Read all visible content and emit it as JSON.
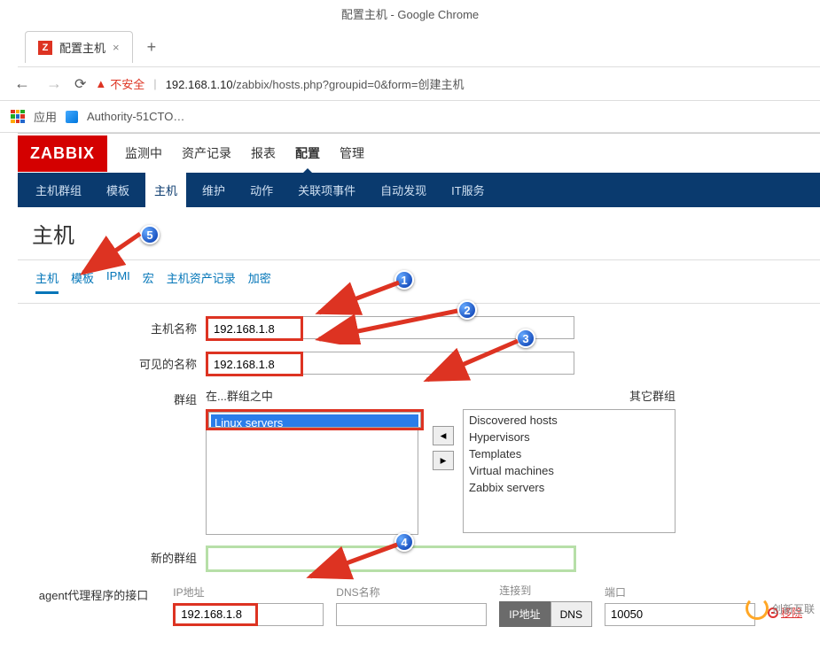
{
  "browser": {
    "window_title": "配置主机 - Google Chrome",
    "tab_title": "配置主机",
    "tab_icon_letter": "Z",
    "security_label": "不安全",
    "url_host": "192.168.1.10",
    "url_path": "/zabbix/hosts.php?groupid=0&form=创建主机",
    "apps_label": "应用",
    "bookmark_1": "Authority-51CTO…"
  },
  "zabbix": {
    "logo_text": "ZABBIX",
    "main_menu": [
      "监测中",
      "资产记录",
      "报表",
      "配置",
      "管理"
    ],
    "main_active_index": 3,
    "sub_menu": [
      "主机群组",
      "模板",
      "主机",
      "维护",
      "动作",
      "关联项事件",
      "自动发现",
      "IT服务"
    ],
    "sub_active_index": 2,
    "page_title": "主机",
    "form_tabs": [
      "主机",
      "模板",
      "IPMI",
      "宏",
      "主机资产记录",
      "加密"
    ],
    "form_tab_active_index": 0,
    "labels": {
      "host_name": "主机名称",
      "visible_name": "可见的名称",
      "groups": "群组",
      "in_group": "在...群组之中",
      "other_groups": "其它群组",
      "new_group": "新的群组",
      "agent_interfaces": "agent代理程序的接口",
      "ip_addr": "IP地址",
      "dns_name": "DNS名称",
      "connect_to": "连接到",
      "port": "端口",
      "btn_ip": "IP地址",
      "btn_dns": "DNS",
      "remove": "移除"
    },
    "values": {
      "host_name": "192.168.1.8",
      "visible_name": "192.168.1.8",
      "selected_group": "Linux servers",
      "other_groups_list": [
        "Discovered hosts",
        "Hypervisors",
        "Templates",
        "Virtual machines",
        "Zabbix servers"
      ],
      "new_group": "",
      "iface_ip": "192.168.1.8",
      "iface_dns": "",
      "iface_port": "10050"
    }
  },
  "annotations": [
    "1",
    "2",
    "3",
    "4",
    "5"
  ],
  "footer_brand": "创新互联"
}
